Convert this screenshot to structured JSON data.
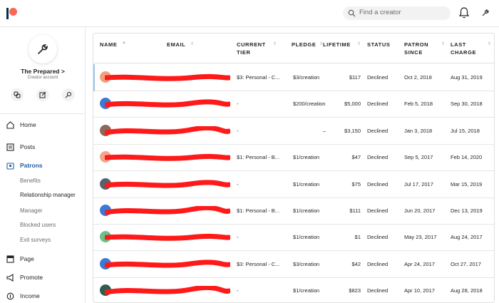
{
  "header": {
    "search_placeholder": "Find a creator",
    "icons": [
      "patreon-logo",
      "search-icon",
      "bell-icon",
      "wrench-icon"
    ]
  },
  "creator": {
    "name": "The Prepared >",
    "subtitle": "Creator account",
    "quick_icons": [
      "link-icon",
      "edit-icon",
      "settings-icon"
    ]
  },
  "nav": {
    "home": "Home",
    "posts": "Posts",
    "patrons": "Patrons",
    "sub": {
      "benefits": "Benefits",
      "relationship_manager": "Relationship manager",
      "manager": "Manager",
      "blocked_users": "Blocked users",
      "exit_surveys": "Exit surveys"
    },
    "page": "Page",
    "promote": "Promote",
    "income": "Income"
  },
  "table": {
    "columns": {
      "name": "NAME",
      "email": "EMAIL",
      "tier_line1": "CURRENT",
      "tier_line2": "TIER",
      "pledge": "PLEDGE",
      "lifetime": "LIFETIME",
      "status": "STATUS",
      "since_line1": "PATRON",
      "since_line2": "SINCE",
      "charge_line1": "LAST",
      "charge_line2": "CHARGE"
    },
    "rows": [
      {
        "tier": "$3: Personal - C...",
        "pledge": "$3/creation",
        "lifetime": "$117",
        "status": "Declined",
        "since": "Oct 2, 2018",
        "charge": "Aug 31, 2019",
        "avatar_color": "#f0a080"
      },
      {
        "tier": "-",
        "pledge": "$200/creation",
        "lifetime": "$5,000",
        "status": "Declined",
        "since": "Feb 5, 2018",
        "charge": "Sep 30, 2018",
        "avatar_color": "#3a7bd5"
      },
      {
        "tier": "-",
        "pledge": "–",
        "lifetime": "$3,150",
        "status": "Declined",
        "since": "Jan 3, 2018",
        "charge": "Jul 15, 2018",
        "avatar_color": "#8a6a5a"
      },
      {
        "tier": "$1: Personal - B...",
        "pledge": "$1/creation",
        "lifetime": "$47",
        "status": "Declined",
        "since": "Sep 5, 2017",
        "charge": "Feb 14, 2020",
        "avatar_color": "#f4a58a"
      },
      {
        "tier": "-",
        "pledge": "$1/creation",
        "lifetime": "$75",
        "status": "Declined",
        "since": "Jul 17, 2017",
        "charge": "Mar 15, 2019",
        "avatar_color": "#556270"
      },
      {
        "tier": "$1: Personal - B...",
        "pledge": "$1/creation",
        "lifetime": "$111",
        "status": "Declined",
        "since": "Jun 20, 2017",
        "charge": "Dec 13, 2019",
        "avatar_color": "#3a7bd5"
      },
      {
        "tier": "-",
        "pledge": "$1/creation",
        "lifetime": "$1",
        "status": "Declined",
        "since": "May 23, 2017",
        "charge": "Aug 24, 2017",
        "avatar_color": "#6cc08a"
      },
      {
        "tier": "$3: Personal - C...",
        "pledge": "$3/creation",
        "lifetime": "$42",
        "status": "Declined",
        "since": "Apr 24, 2017",
        "charge": "Oct 27, 2017",
        "avatar_color": "#3a7bd5"
      },
      {
        "tier": "-",
        "pledge": "$1/creation",
        "lifetime": "$823",
        "status": "Declined",
        "since": "Apr 10, 2017",
        "charge": "Aug 28, 2018",
        "avatar_color": "#2f5d50"
      }
    ]
  },
  "colors": {
    "brand_coral": "#f96854",
    "brand_navy": "#052d49",
    "active_nav": "#1f5fa0",
    "redaction": "#ff1a1a"
  }
}
